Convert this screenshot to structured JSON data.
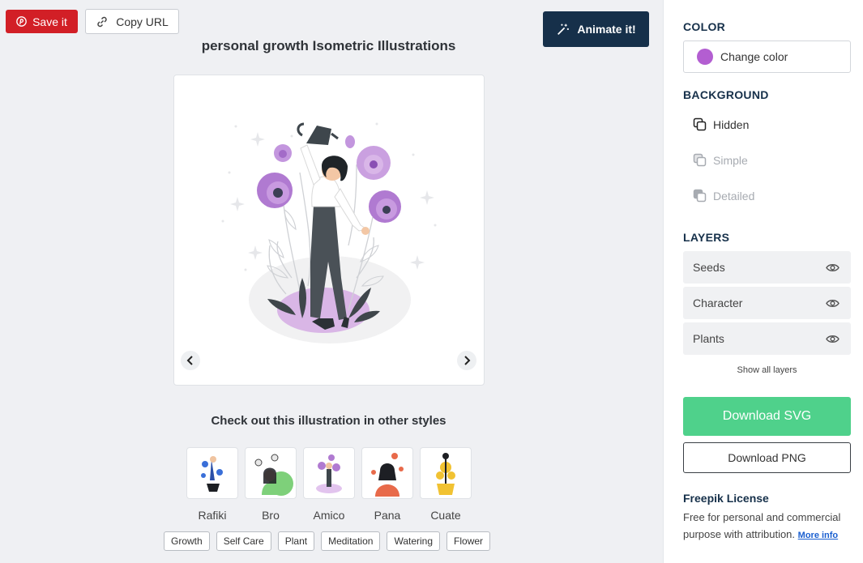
{
  "toolbar": {
    "save_label": "Save it",
    "copy_label": "Copy URL",
    "animate_label": "Animate it!"
  },
  "illustration": {
    "title": "personal growth Isometric Illustrations"
  },
  "other_styles": {
    "title": "Check out this illustration in other styles",
    "items": [
      {
        "label": "Rafiki"
      },
      {
        "label": "Bro"
      },
      {
        "label": "Amico"
      },
      {
        "label": "Pana"
      },
      {
        "label": "Cuate"
      }
    ]
  },
  "tags": [
    "Growth",
    "Self Care",
    "Plant",
    "Meditation",
    "Watering",
    "Flower"
  ],
  "panel": {
    "color": {
      "heading": "COLOR",
      "button_label": "Change color",
      "swatch": "#b35ed1"
    },
    "background": {
      "heading": "BACKGROUND",
      "options": [
        {
          "label": "Hidden",
          "selected": true
        },
        {
          "label": "Simple",
          "selected": false
        },
        {
          "label": "Detailed",
          "selected": false
        }
      ]
    },
    "layers": {
      "heading": "LAYERS",
      "items": [
        {
          "label": "Seeds"
        },
        {
          "label": "Character"
        },
        {
          "label": "Plants"
        }
      ],
      "show_all": "Show all layers"
    },
    "download_svg": "Download SVG",
    "download_png": "Download PNG",
    "license": {
      "heading": "Freepik License",
      "text": "Free for personal and commercial purpose with attribution.",
      "more_info": "More info"
    }
  },
  "colors": {
    "accent_purple": "#b35ed1",
    "save_red": "#d21f26",
    "navy": "#16304a",
    "download_green": "#4fd18b"
  }
}
